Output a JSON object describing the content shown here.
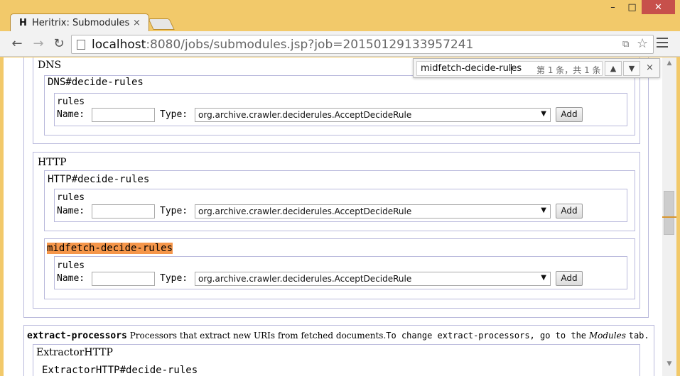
{
  "browser": {
    "tab_title": "Heritrix: Submodules",
    "tab_favicon": "H",
    "tab_close": "×",
    "window_controls": {
      "minimize": "–",
      "maximize": "□",
      "close": "✕"
    },
    "url_host": "localhost",
    "url_rest": ":8080/jobs/submodules.jsp?job=20150129133957241",
    "icons": {
      "back": "back-arrow-icon",
      "forward": "forward-arrow-icon",
      "reload": "reload-icon",
      "page": "page-icon",
      "translate": "translate-icon",
      "star": "star-icon",
      "menu": "hamburger-menu-icon"
    }
  },
  "find": {
    "query": "midfetch-decide-rules",
    "count_text": "第 1 条，共 1 条",
    "prev": "⌃",
    "next": "⌄",
    "close": "×"
  },
  "form": {
    "name_label": "Name:",
    "type_label": "Type:",
    "rules_label": "rules",
    "type_value": "org.archive.crawler.deciderules.AcceptDecideRule",
    "add_label": "Add"
  },
  "modules": {
    "dns": {
      "title": "DNS",
      "decide_rules": "DNS#decide-rules"
    },
    "http": {
      "title": "HTTP",
      "decide_rules": "HTTP#decide-rules",
      "midfetch": "midfetch-decide-rules"
    },
    "extract": {
      "title": "extract-processors",
      "desc_1": "Processors that extract new URIs from fetched documents.",
      "desc_2": "To change extract-processors, go to the",
      "desc_modules": "Modules",
      "desc_3": "tab.",
      "extractor_http": "ExtractorHTTP",
      "extractor_http_rules": "ExtractorHTTP#decide-rules"
    }
  },
  "colors": {
    "frame": "#f2c96a",
    "highlight": "#f5964a",
    "module_border": "#b9b9dc"
  }
}
